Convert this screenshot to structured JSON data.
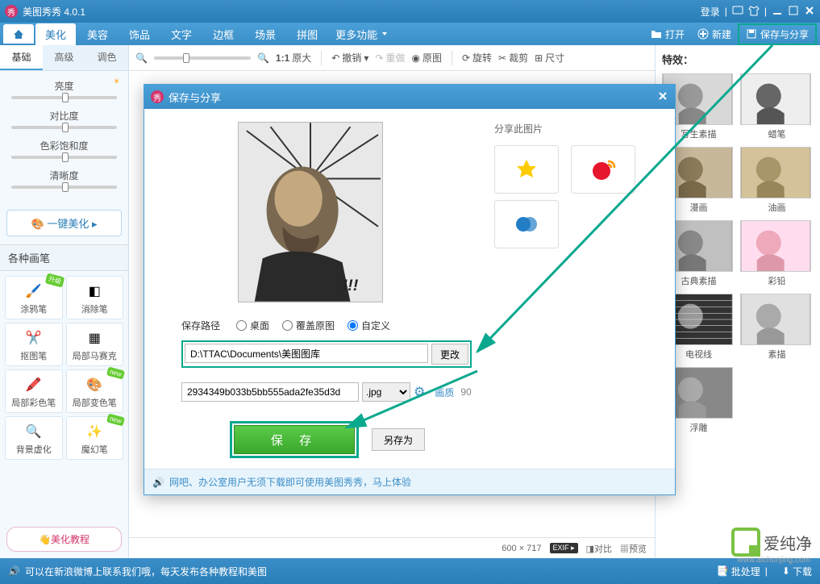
{
  "app": {
    "title": "美图秀秀 4.0.1",
    "login": "登录"
  },
  "menu": {
    "tabs": [
      "美化",
      "美容",
      "饰品",
      "文字",
      "边框",
      "场景",
      "拼图"
    ],
    "more": "更多功能",
    "open": "打开",
    "new": "新建",
    "save_share": "保存与分享"
  },
  "subtabs": [
    "基础",
    "高级",
    "调色"
  ],
  "sliders": {
    "brightness": "亮度",
    "contrast": "对比度",
    "saturation": "色彩饱和度",
    "sharpness": "清晰度"
  },
  "one_click": "一键美化",
  "brush_section": "各种画笔",
  "brushes": [
    {
      "label": "涂鸦笔",
      "badge": "升级"
    },
    {
      "label": "消除笔"
    },
    {
      "label": "抠图笔"
    },
    {
      "label": "局部马赛克"
    },
    {
      "label": "局部彩色笔"
    },
    {
      "label": "局部变色笔",
      "badge": "new"
    },
    {
      "label": "背景虚化"
    },
    {
      "label": "魔幻笔",
      "badge": "new"
    }
  ],
  "tutorial": "美化教程",
  "toolbar": {
    "scale": "1:1",
    "original_size": "原大",
    "undo": "撤销",
    "redo": "重做",
    "original": "原图",
    "rotate": "旋转",
    "crop": "裁剪",
    "size": "尺寸"
  },
  "canvas_footer": {
    "dimensions": "600 × 717",
    "exif": "EXIF",
    "compare": "对比",
    "preview": "预览"
  },
  "effects": {
    "title": "特效：",
    "items": [
      "写生素描",
      "蜡笔",
      "漫画",
      "油画",
      "古典素描",
      "彩铅",
      "电视线",
      "素描",
      "浮雕"
    ]
  },
  "statusbar": {
    "msg": "可以在新浪微博上联系我们哦，每天发布各种教程和美图",
    "batch": "批处理",
    "download": "下载"
  },
  "dialog": {
    "title": "保存与分享",
    "path_label": "保存路径",
    "radio_desktop": "桌面",
    "radio_overwrite": "覆盖原图",
    "radio_custom": "自定义",
    "path_value": "D:\\TTAC\\Documents\\美图图库",
    "change_btn": "更改",
    "filename": "2934349b033b5bb555ada2fe35d3d",
    "ext": ".jpg",
    "quality_label": "画质",
    "quality_val": "90",
    "save_btn": "保 存",
    "saveas_btn": "另存为",
    "share_title": "分享此图片",
    "footer_msg": "网吧、办公室用户无须下载即可使用美图秀秀，马上体验"
  },
  "watermark": {
    "text": "爱纯净",
    "url": "www.aichunjing.com"
  }
}
